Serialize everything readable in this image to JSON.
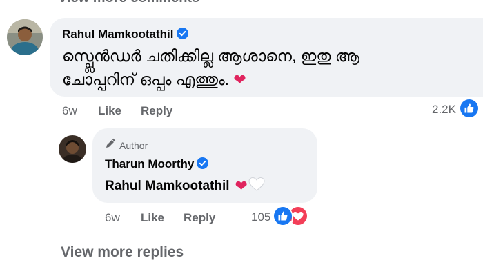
{
  "top_link": "View more comments",
  "comment": {
    "author": "Rahul Mamkootathil",
    "text_line1": "സ്പ്ലെൻഡർ ചതിക്കില്ല ആശാനെ, ഇതു ആ",
    "text_line2": "ചോപ്പറിന് ഒപ്പം എത്തും.",
    "time": "6w",
    "like": "Like",
    "reply": "Reply",
    "reaction_count": "2.2K",
    "reaction_icons": [
      "like-icon"
    ]
  },
  "reply": {
    "badge": "Author",
    "author": "Tharun Moorthy",
    "text": "Rahul Mamkootathil",
    "time": "6w",
    "like": "Like",
    "reply": "Reply",
    "reaction_count": "105",
    "reaction_icons": [
      "like-icon",
      "love-icon"
    ]
  },
  "view_more_replies": "View more replies",
  "colors": {
    "bubble": "#f0f2f5",
    "secondary_text": "#65676b",
    "facebook_blue": "#1877f2",
    "heart_red": "#e0245e"
  }
}
